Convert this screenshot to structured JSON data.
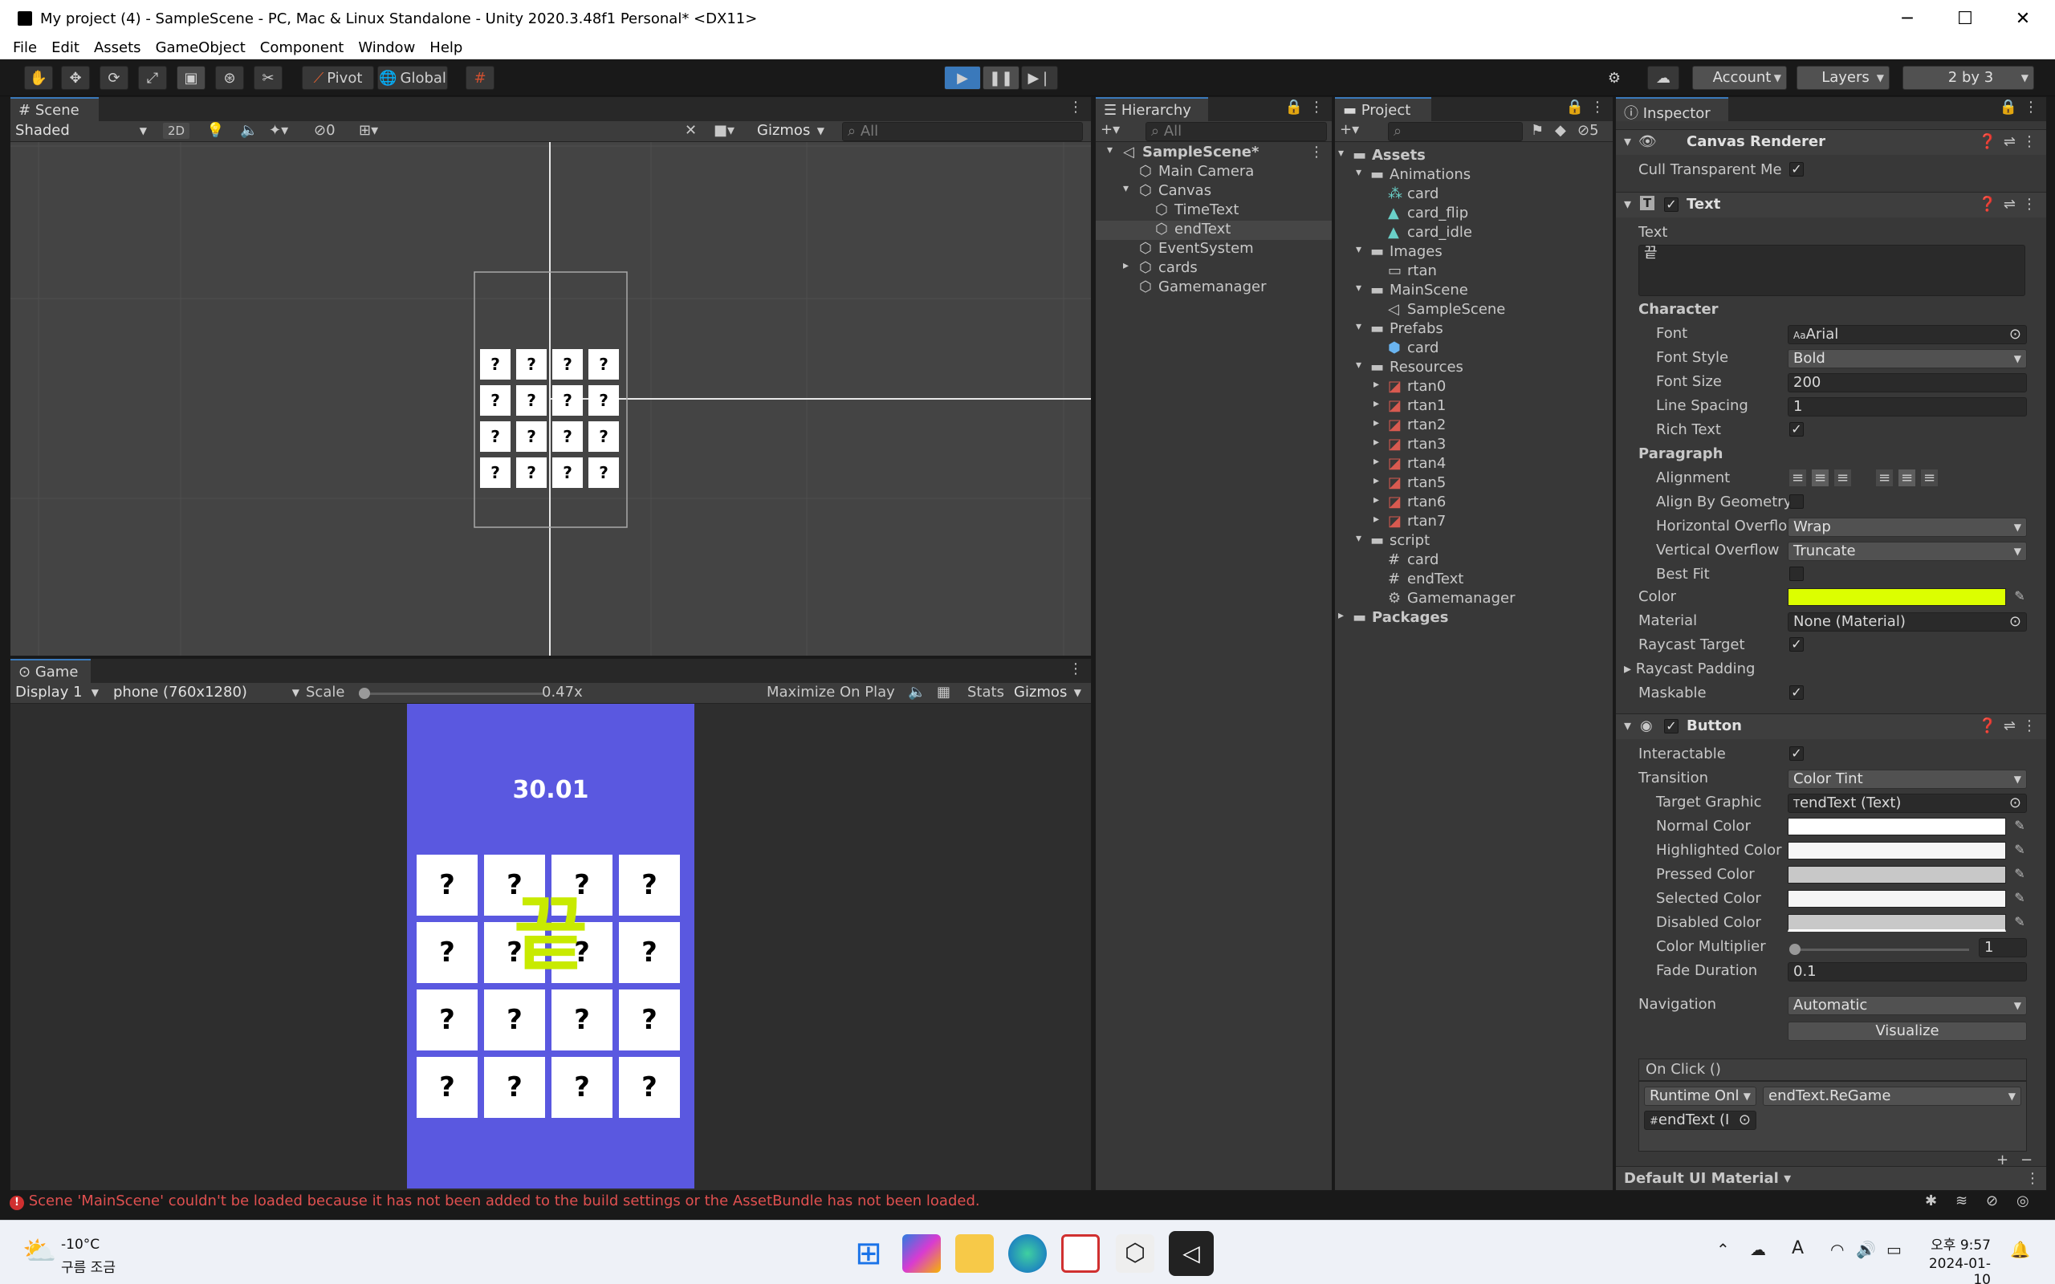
{
  "window": {
    "title": "My project (4) - SampleScene - PC, Mac & Linux Standalone - Unity 2020.3.48f1 Personal* <DX11>",
    "minimize": "─",
    "maximize": "☐",
    "close": "✕"
  },
  "menu": [
    "File",
    "Edit",
    "Assets",
    "GameObject",
    "Component",
    "Window",
    "Help"
  ],
  "toolbar": {
    "pivot": "Pivot",
    "global": "Global",
    "account": "Account",
    "layers": "Layers",
    "layout": "2 by 3"
  },
  "scene": {
    "tab": "Scene",
    "shading": "Shaded",
    "mode2d": "2D",
    "hidden_count": "0",
    "gizmos": "Gizmos",
    "search_placeholder": "All",
    "card_mark": "?"
  },
  "game": {
    "tab": "Game",
    "display": "Display 1",
    "resolution": "phone (760x1280)",
    "scale_label": "Scale",
    "scale_value": "0.47x",
    "scale_fraction": 0.47,
    "maximize": "Maximize On Play",
    "stats": "Stats",
    "gizmos": "Gizmos",
    "timer": "30.01",
    "end_text": "끝",
    "end_color": "#c8ea00",
    "bg_color": "#5a58e0",
    "card_mark": "?"
  },
  "hierarchy": {
    "tab": "Hierarchy",
    "search_placeholder": "All",
    "items": [
      {
        "label": "SampleScene*",
        "depth": 0,
        "icon": "unity-scene-icon"
      },
      {
        "label": "Main Camera",
        "depth": 1,
        "icon": "gameobject-icon"
      },
      {
        "label": "Canvas",
        "depth": 1,
        "icon": "gameobject-icon"
      },
      {
        "label": "TimeText",
        "depth": 2,
        "icon": "gameobject-icon"
      },
      {
        "label": "endText",
        "depth": 2,
        "icon": "gameobject-icon"
      },
      {
        "label": "EventSystem",
        "depth": 1,
        "icon": "gameobject-icon"
      },
      {
        "label": "cards",
        "depth": 1,
        "icon": "gameobject-icon"
      },
      {
        "label": "Gamemanager",
        "depth": 1,
        "icon": "gameobject-icon"
      }
    ]
  },
  "project": {
    "tab": "Project",
    "hidden_count": "5",
    "items": [
      {
        "label": "Assets",
        "depth": 0,
        "icon": "folder-icon"
      },
      {
        "label": "Animations",
        "depth": 1,
        "icon": "folder-icon"
      },
      {
        "label": "card",
        "depth": 2,
        "icon": "animator-icon"
      },
      {
        "label": "card_flip",
        "depth": 2,
        "icon": "animation-icon"
      },
      {
        "label": "card_idle",
        "depth": 2,
        "icon": "animation-icon"
      },
      {
        "label": "Images",
        "depth": 1,
        "icon": "folder-icon"
      },
      {
        "label": "rtan",
        "depth": 2,
        "icon": "empty-folder-icon"
      },
      {
        "label": "MainScene",
        "depth": 1,
        "icon": "folder-icon"
      },
      {
        "label": "SampleScene",
        "depth": 2,
        "icon": "unity-scene-icon"
      },
      {
        "label": "Prefabs",
        "depth": 1,
        "icon": "folder-icon"
      },
      {
        "label": "card",
        "depth": 2,
        "icon": "prefab-icon"
      },
      {
        "label": "Resources",
        "depth": 1,
        "icon": "folder-icon"
      },
      {
        "label": "rtan0",
        "depth": 2,
        "icon": "sprite-icon"
      },
      {
        "label": "rtan1",
        "depth": 2,
        "icon": "sprite-icon"
      },
      {
        "label": "rtan2",
        "depth": 2,
        "icon": "sprite-icon"
      },
      {
        "label": "rtan3",
        "depth": 2,
        "icon": "sprite-icon"
      },
      {
        "label": "rtan4",
        "depth": 2,
        "icon": "sprite-icon"
      },
      {
        "label": "rtan5",
        "depth": 2,
        "icon": "sprite-icon"
      },
      {
        "label": "rtan6",
        "depth": 2,
        "icon": "sprite-icon"
      },
      {
        "label": "rtan7",
        "depth": 2,
        "icon": "sprite-icon"
      },
      {
        "label": "script",
        "depth": 1,
        "icon": "folder-icon"
      },
      {
        "label": "card",
        "depth": 2,
        "icon": "csharp-script-icon"
      },
      {
        "label": "endText",
        "depth": 2,
        "icon": "csharp-script-icon"
      },
      {
        "label": "Gamemanager",
        "depth": 2,
        "icon": "gear-script-icon"
      },
      {
        "label": "Packages",
        "depth": 0,
        "icon": "folder-icon"
      }
    ]
  },
  "inspector": {
    "tab": "Inspector",
    "canvas_renderer": {
      "title": "Canvas Renderer",
      "cull_label": "Cull Transparent Me"
    },
    "text": {
      "title": "Text",
      "text_label": "Text",
      "text_value": "끝",
      "character": "Character",
      "font_label": "Font",
      "font_value": "Arial",
      "font_style_label": "Font Style",
      "font_style_value": "Bold",
      "font_size_label": "Font Size",
      "font_size_value": "200",
      "line_spacing_label": "Line Spacing",
      "line_spacing_value": "1",
      "rich_text_label": "Rich Text",
      "paragraph": "Paragraph",
      "alignment_label": "Alignment",
      "align_geom_label": "Align By Geometry",
      "h_overflow_label": "Horizontal Overflo",
      "h_overflow_value": "Wrap",
      "v_overflow_label": "Vertical Overflow",
      "v_overflow_value": "Truncate",
      "best_fit_label": "Best Fit",
      "color_label": "Color",
      "color_value": "#dcff00",
      "material_label": "Material",
      "material_value": "None (Material)",
      "raycast_target_label": "Raycast Target",
      "raycast_padding_label": "Raycast Padding",
      "maskable_label": "Maskable"
    },
    "button": {
      "title": "Button",
      "interactable_label": "Interactable",
      "transition_label": "Transition",
      "transition_value": "Color Tint",
      "target_graphic_label": "Target Graphic",
      "target_graphic_value": "endText (Text)",
      "normal_label": "Normal Color",
      "highlighted_label": "Highlighted Color",
      "pressed_label": "Pressed Color",
      "selected_label": "Selected Color",
      "disabled_label": "Disabled Color",
      "multiplier_label": "Color Multiplier",
      "multiplier_value": "1",
      "fade_label": "Fade Duration",
      "fade_value": "0.1",
      "navigation_label": "Navigation",
      "navigation_value": "Automatic",
      "visualize": "Visualize",
      "onclick": "On Click ()",
      "runtime_value": "Runtime Onl",
      "function_value": "endText.ReGame",
      "object_value": "endText (I",
      "add": "+",
      "remove": "−"
    },
    "default_material": "Default UI Material"
  },
  "status": {
    "error": "Scene 'MainScene' couldn't be loaded because it has not been added to the build settings or the AssetBundle has not been loaded."
  },
  "taskbar": {
    "temp": "-10°C",
    "weather": "구름 조금",
    "time": "오후 9:57",
    "date": "2024-01-10",
    "ime": "A"
  }
}
